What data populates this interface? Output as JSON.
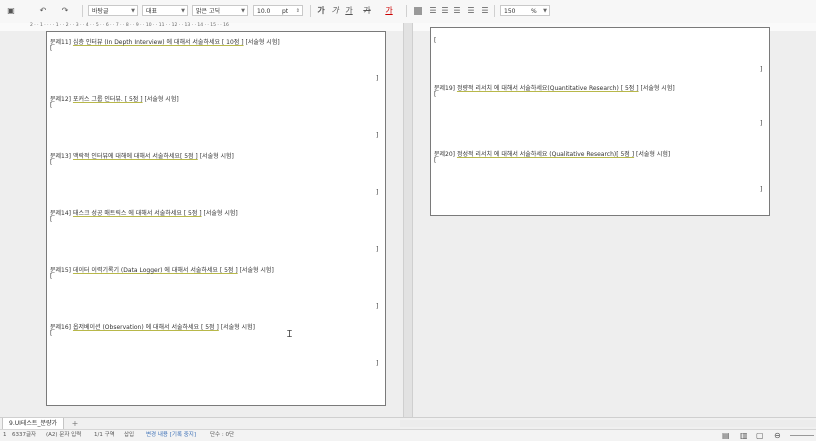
{
  "toolbar": {
    "undo": "↶",
    "redo": "↷",
    "style_value": "바탕글",
    "lang_value": "대표",
    "font_value": "맑은 고딕",
    "size_value": "10.0",
    "size_unit": "pt",
    "bold": "가",
    "italic": "가",
    "underline": "가",
    "strike": "가",
    "zoom_value": "150",
    "zoom_unit": "%"
  },
  "ruler": {
    "numbers": "2 · · 1 · · · · 1 · · 2 · · 3 · · 4 · · 5 · · 6 · · 7 · · 8 · · 9 · · 10 · · 11 · · 12 · · 13 · · 14 · · 15 · · 16"
  },
  "left_page": {
    "questions": [
      {
        "num": "문제11]",
        "text": "심층 인터뷰 (In Depth Interview) 에 대해서 서술하세요 [ 10점 ]",
        "type": "[서술형 시험]",
        "open": "[",
        "close": "]"
      },
      {
        "num": "문제12]",
        "text": "포커스 그룹 인터뷰. [ 5점 ]",
        "type": "[서술형 시험]",
        "open": "[",
        "close": "]"
      },
      {
        "num": "문제13]",
        "text": "맥락적 인터뷰에 대해에 대해서 서술하세요[ 5점 ]",
        "type": "[서술형 시험]",
        "open": "[",
        "close": "]"
      },
      {
        "num": "문제14]",
        "text": "태스크 성공 매트릭스 에 대해서 서술하세요 [ 5점 ]",
        "type": "[서술형 시험]",
        "open": "[",
        "close": "]"
      },
      {
        "num": "문제15]",
        "text": "데이터 이력기록기 (Data Logger) 에 대해서 서술하세요 [ 5점 ]",
        "type": "[서술형 시험]",
        "open": "[",
        "close": "]"
      },
      {
        "num": "문제16]",
        "text": "옵저베이션 (Observation) 에 대해서 서술하세요 [ 5점 ]",
        "type": "[서술형 시험]",
        "open": "[",
        "close": "]"
      }
    ]
  },
  "right_page": {
    "questions": [
      {
        "num": "",
        "text": "",
        "type": "",
        "open": "[",
        "close": "]"
      },
      {
        "num": "문제19]",
        "text": "정량적 리서치 에 대해서 서술하세요(Quantitative Research) [ 5점 ]",
        "type": "[서술형 시험]",
        "open": "[",
        "close": "]"
      },
      {
        "num": "문제20]",
        "text": "정성적 리서치 에 대해서 서술하세요 (Qualitative Research)[ 5점 ]",
        "type": "[서술형 시험]",
        "open": "[",
        "close": "]"
      }
    ]
  },
  "tabs": {
    "sheet": "9.UI테스트_분량가",
    "add": "+"
  },
  "status": {
    "page": "1",
    "chars": "6337글자",
    "section": "(A2) 문자 입력",
    "pages": "1/1 구역",
    "insert": "삽입",
    "track": "변경 내용 [기록 중지]",
    "level": "단수 : 0단"
  }
}
